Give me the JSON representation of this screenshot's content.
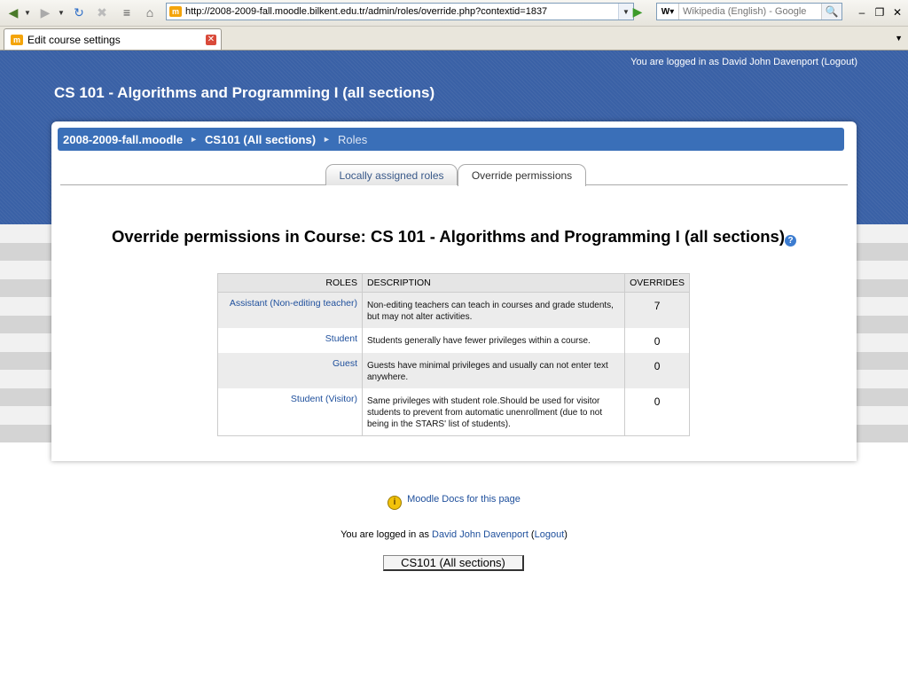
{
  "browser": {
    "url": "http://2008-2009-fall.moodle.bilkent.edu.tr/admin/roles/override.php?contextid=1837",
    "search_placeholder": "Wikipedia (English) - Google",
    "tab_title": "Edit course settings"
  },
  "header": {
    "login_prefix": "You are logged in as",
    "user_name": "David John Davenport",
    "logout_label": "Logout",
    "course_title": "CS 101 - Algorithms and Programming I (all sections)"
  },
  "breadcrumb": {
    "items": [
      "2008-2009-fall.moodle",
      "CS101 (All sections)",
      "Roles"
    ]
  },
  "tabs": {
    "locally_assigned": "Locally assigned roles",
    "override": "Override permissions"
  },
  "page": {
    "heading": "Override permissions in Course: CS 101 - Algorithms and Programming I (all sections)"
  },
  "table": {
    "headers": [
      "ROLES",
      "DESCRIPTION",
      "OVERRIDES"
    ],
    "rows": [
      {
        "role": "Assistant (Non-editing teacher)",
        "description": "Non-editing teachers can teach in courses and grade students, but may not alter activities.",
        "overrides": "7"
      },
      {
        "role": "Student",
        "description": "Students generally have fewer privileges within a course.",
        "overrides": "0"
      },
      {
        "role": "Guest",
        "description": "Guests have minimal privileges and usually can not enter text anywhere.",
        "overrides": "0"
      },
      {
        "role": "Student (Visitor)",
        "description": "Same privileges with student role.Should be used for visitor students to prevent from automatic unenrollment (due to not being in the STARS' list of students).",
        "overrides": "0"
      }
    ]
  },
  "footer": {
    "docs_link": "Moodle Docs for this page",
    "login_prefix": "You are logged in as",
    "user_name": "David John Davenport",
    "logout_label": "Logout",
    "course_button": "CS101 (All sections)"
  }
}
